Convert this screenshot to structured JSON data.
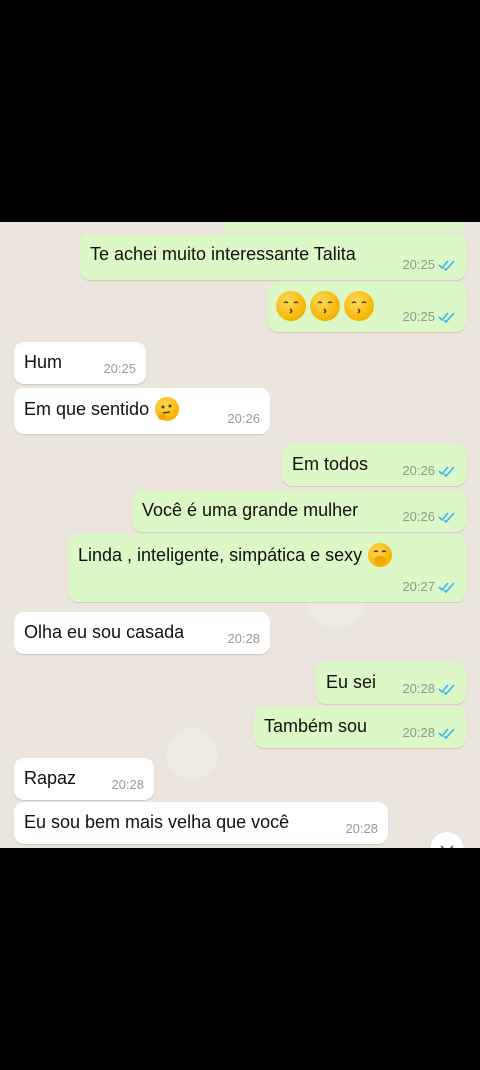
{
  "messages": [
    {
      "dir": "out",
      "text": "Te achei muito interessante Talita",
      "time": "20:25",
      "status": "read"
    },
    {
      "dir": "out",
      "text": "",
      "emoji": [
        "kissing-face",
        "kissing-face",
        "kissing-face"
      ],
      "time": "20:25",
      "status": "read"
    },
    {
      "dir": "in",
      "text": "Hum",
      "time": "20:25"
    },
    {
      "dir": "in",
      "text": "Em que sentido",
      "emoji": [
        "thinking-face"
      ],
      "time": "20:26"
    },
    {
      "dir": "out",
      "text": "Em todos",
      "time": "20:26",
      "status": "read"
    },
    {
      "dir": "out",
      "text": "Você é uma grande mulher",
      "time": "20:26",
      "status": "read"
    },
    {
      "dir": "out",
      "text": "Linda , inteligente, simpática e sexy",
      "emoji": [
        "hand-over-mouth-face"
      ],
      "time": "20:27",
      "status": "read"
    },
    {
      "dir": "in",
      "text": "Olha eu sou casada",
      "time": "20:28"
    },
    {
      "dir": "out",
      "text": "Eu sei",
      "time": "20:28",
      "status": "read"
    },
    {
      "dir": "out",
      "text": "Também sou",
      "time": "20:28",
      "status": "read"
    },
    {
      "dir": "in",
      "text": "Rapaz",
      "time": "20:28"
    },
    {
      "dir": "in",
      "text": "Eu sou bem mais velha que você",
      "time": "20:28"
    }
  ],
  "colors": {
    "outgoing_bubble": "#dcf8c6",
    "incoming_bubble": "#ffffff",
    "read_ticks": "#34b7f1",
    "chat_background": "#ece5dd"
  }
}
